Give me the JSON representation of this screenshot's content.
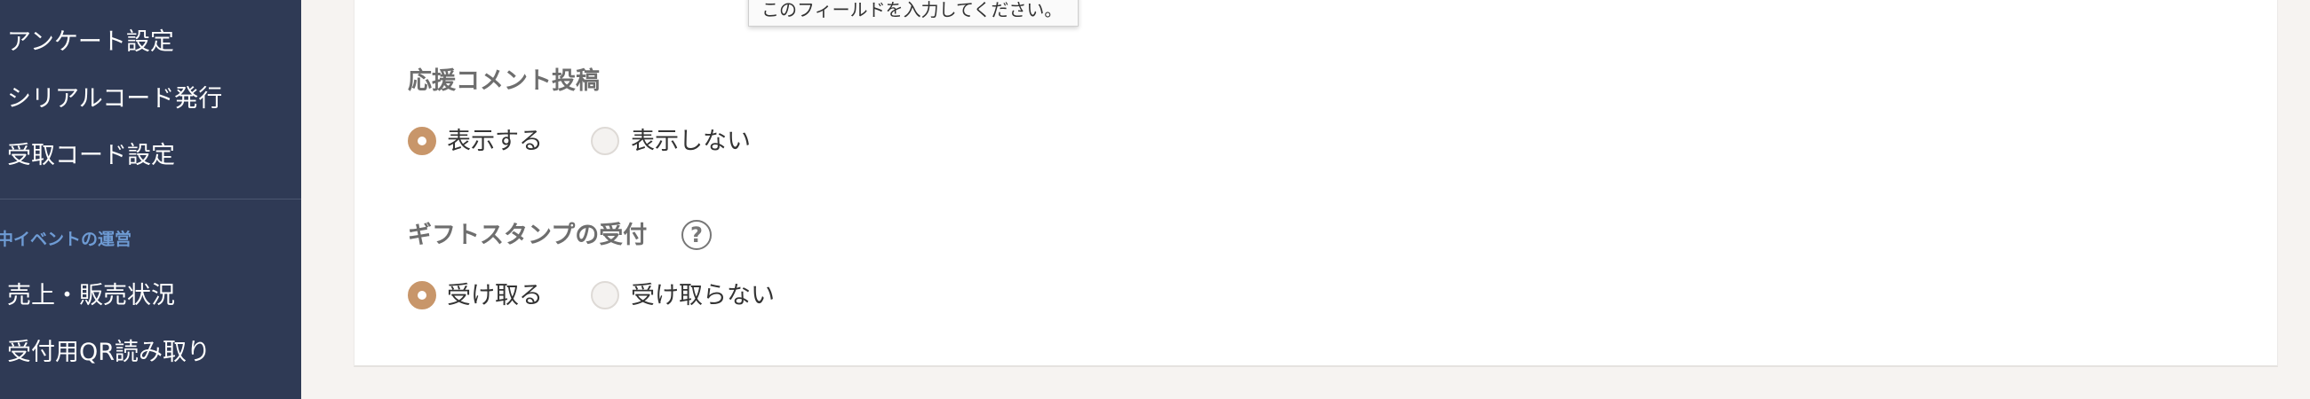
{
  "sidebar": {
    "items_top": [
      {
        "label": "アンケート設定"
      },
      {
        "label": "シリアルコード発行"
      },
      {
        "label": "受取コード設定"
      }
    ],
    "section_title": "中イベントの運営",
    "items_bottom": [
      {
        "label": "売上・販売状況"
      },
      {
        "label": "受付用QR読み取り"
      }
    ]
  },
  "tooltip": {
    "text": "このフィールドを入力してください。"
  },
  "form": {
    "support_comment": {
      "label": "応援コメント投稿",
      "options": [
        {
          "label": "表示する",
          "selected": true
        },
        {
          "label": "表示しない",
          "selected": false
        }
      ]
    },
    "gift_stamp": {
      "label": "ギフトスタンプの受付",
      "help_icon": "?",
      "options": [
        {
          "label": "受け取る",
          "selected": true
        },
        {
          "label": "受け取らない",
          "selected": false
        }
      ]
    }
  },
  "colors": {
    "sidebar_bg": "#2f3a55",
    "accent": "#c8966a",
    "section_title": "#6e9bd4"
  }
}
